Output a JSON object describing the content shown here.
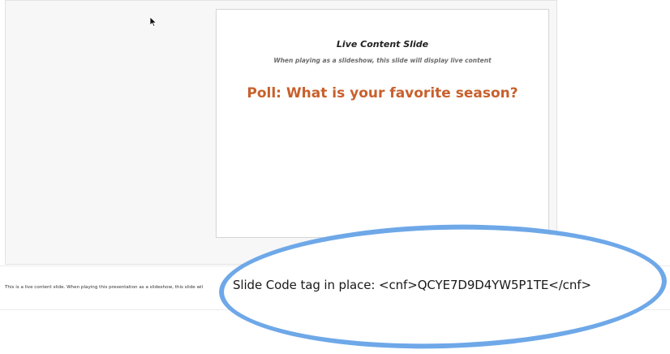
{
  "slide": {
    "title": "Live Content Slide",
    "subtitle": "When playing as a slideshow, this slide will display live content",
    "poll_text": "Poll: What is your favorite season?"
  },
  "notes": {
    "text": "This is a live content slide. When playing this presentation as a slideshow, this slide wil"
  },
  "callout": {
    "code_tag_text": "Slide Code tag in place: <cnf>QCYE7D9D4YW5P1TE</cnf>"
  },
  "colors": {
    "poll": "#c8602c",
    "callout_outline": "#6ea8e8"
  },
  "icons": {
    "cursor": "mouse-pointer-icon"
  }
}
